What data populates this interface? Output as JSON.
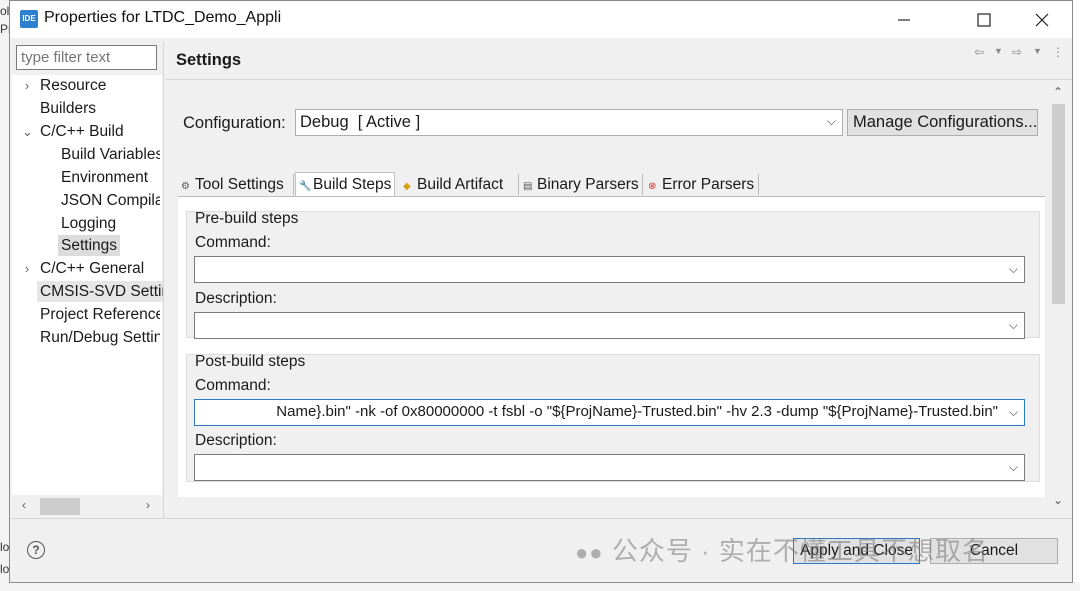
{
  "window": {
    "title": "Properties for LTDC_Demo_Appli",
    "app_icon": "IDE",
    "minimize": "—",
    "maximize": "☐",
    "close": "✕"
  },
  "background_fragments": [
    "ol",
    "Pr",
    "lo",
    "lo"
  ],
  "filter": {
    "placeholder": "type filter text"
  },
  "tree": [
    {
      "label": "Resource",
      "expandable": true,
      "expanded": false
    },
    {
      "label": "Builders"
    },
    {
      "label": "C/C++ Build",
      "expandable": true,
      "expanded": true
    },
    {
      "label": "Build Variables"
    },
    {
      "label": "Environment"
    },
    {
      "label": "JSON Compilation Database"
    },
    {
      "label": "Logging"
    },
    {
      "label": "Settings",
      "selected": true
    },
    {
      "label": "C/C++ General",
      "expandable": true,
      "expanded": false
    },
    {
      "label": "CMSIS-SVD Settings"
    },
    {
      "label": "Project References"
    },
    {
      "label": "Run/Debug Settings"
    }
  ],
  "panel": {
    "title": "Settings"
  },
  "configuration": {
    "label": "Configuration:",
    "value": "Debug  [ Active ]",
    "manage_label": "Manage Configurations..."
  },
  "tabs": [
    {
      "label": "Tool Settings",
      "icon": "tool-settings-icon",
      "active": false
    },
    {
      "label": "Build Steps",
      "icon": "wrench-icon",
      "active": true
    },
    {
      "label": "Build Artifact",
      "icon": "trophy-icon",
      "active": false
    },
    {
      "label": "Binary Parsers",
      "icon": "binary-icon",
      "active": false
    },
    {
      "label": "Error Parsers",
      "icon": "error-icon",
      "active": false
    }
  ],
  "pre_build": {
    "title": "Pre-build steps",
    "command_label": "Command:",
    "command_value": "",
    "description_label": "Description:",
    "description_value": ""
  },
  "post_build": {
    "title": "Post-build steps",
    "command_label": "Command:",
    "command_value": "Name}.bin\" -nk -of 0x80000000 -t fsbl -o \"${ProjName}-Trusted.bin\" -hv 2.3 -dump \"${ProjName}-Trusted.bin\"",
    "description_label": "Description:",
    "description_value": ""
  },
  "buttons": {
    "help": "?",
    "apply_close": "Apply and Close",
    "cancel": "Cancel"
  },
  "watermark": "公众号 · 实在不懂工具不想取名",
  "colors": {
    "accent": "#2b78c8",
    "selection": "#dcdcdc",
    "dialog_bg": "#f0f0f0"
  }
}
